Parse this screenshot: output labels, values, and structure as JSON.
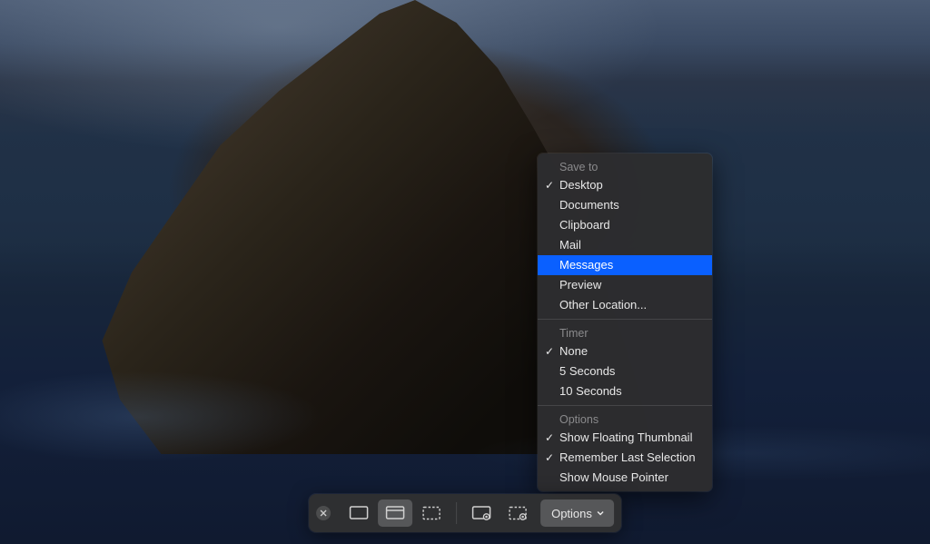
{
  "toolbar": {
    "options_label": "Options"
  },
  "menu": {
    "sections": {
      "save_to": {
        "label": "Save to",
        "items": [
          {
            "label": "Desktop",
            "checked": true,
            "highlighted": false
          },
          {
            "label": "Documents",
            "checked": false,
            "highlighted": false
          },
          {
            "label": "Clipboard",
            "checked": false,
            "highlighted": false
          },
          {
            "label": "Mail",
            "checked": false,
            "highlighted": false
          },
          {
            "label": "Messages",
            "checked": false,
            "highlighted": true
          },
          {
            "label": "Preview",
            "checked": false,
            "highlighted": false
          },
          {
            "label": "Other Location...",
            "checked": false,
            "highlighted": false
          }
        ]
      },
      "timer": {
        "label": "Timer",
        "items": [
          {
            "label": "None",
            "checked": true,
            "highlighted": false
          },
          {
            "label": "5 Seconds",
            "checked": false,
            "highlighted": false
          },
          {
            "label": "10 Seconds",
            "checked": false,
            "highlighted": false
          }
        ]
      },
      "options": {
        "label": "Options",
        "items": [
          {
            "label": "Show Floating Thumbnail",
            "checked": true,
            "highlighted": false
          },
          {
            "label": "Remember Last Selection",
            "checked": true,
            "highlighted": false
          },
          {
            "label": "Show Mouse Pointer",
            "checked": false,
            "highlighted": false
          }
        ]
      }
    }
  }
}
